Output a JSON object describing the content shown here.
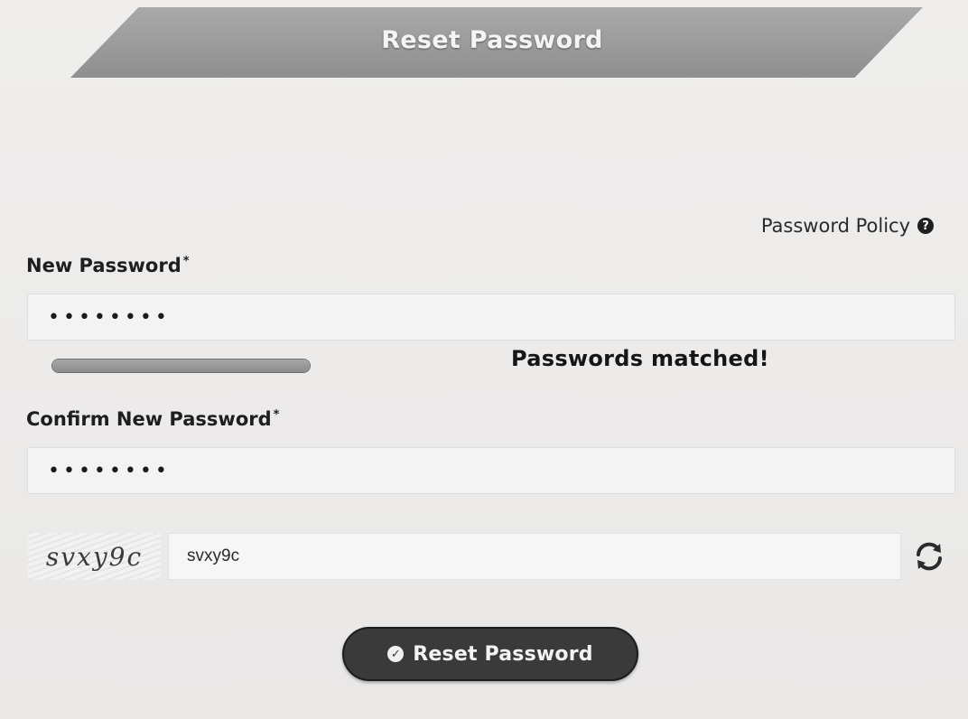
{
  "header": {
    "title": "Reset Password"
  },
  "policy": {
    "label": "Password Policy",
    "icon": "question-circle-icon"
  },
  "new_password": {
    "label": "New Password",
    "required_marker": "*",
    "value": "••••••••"
  },
  "strength": {
    "level": 1.0
  },
  "match_message": "Passwords matched!",
  "confirm_password": {
    "label": "Confirm New Password",
    "required_marker": "*",
    "value": "••••••••"
  },
  "captcha": {
    "image_text": "svxy9c",
    "input_value": "svxy9c",
    "refresh_icon": "refresh-icon"
  },
  "submit": {
    "label": "Reset Password",
    "icon": "check-circle-icon"
  }
}
